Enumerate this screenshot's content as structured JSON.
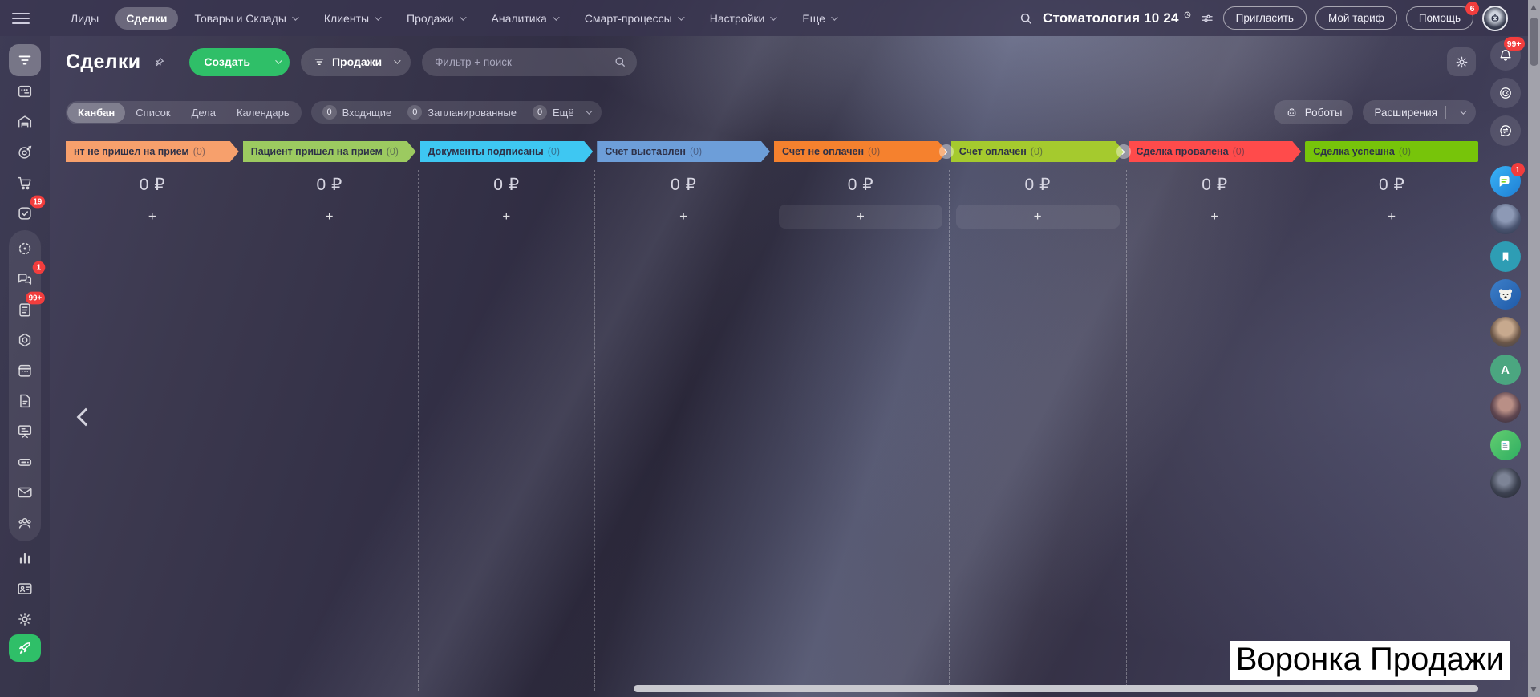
{
  "topbar": {
    "nav": [
      {
        "label": "Лиды"
      },
      {
        "label": "Сделки"
      },
      {
        "label": "Товары и Склады"
      },
      {
        "label": "Клиенты"
      },
      {
        "label": "Продажи"
      },
      {
        "label": "Аналитика"
      },
      {
        "label": "Смарт-процессы"
      },
      {
        "label": "Настройки"
      },
      {
        "label": "Еще"
      }
    ],
    "company_name": "Стоматология 10 24",
    "invite_button": "Пригласить",
    "tariff_button": "Мой тариф",
    "help_button": "Помощь",
    "help_badge": "6"
  },
  "toolbar": {
    "page_title": "Сделки",
    "create_button": "Создать",
    "funnel_selector": "Продажи",
    "filter_placeholder": "Фильтр + поиск"
  },
  "tabs_row": {
    "tabs": [
      {
        "label": "Канбан"
      },
      {
        "label": "Список"
      },
      {
        "label": "Дела"
      },
      {
        "label": "Календарь"
      }
    ],
    "counters": [
      {
        "count": "0",
        "label": "Входящие"
      },
      {
        "count": "0",
        "label": "Запланированные"
      },
      {
        "count": "0",
        "label": "Ещё"
      }
    ],
    "robots_button": "Роботы",
    "extensions_button": "Расширения"
  },
  "kanban": {
    "add_label": "+",
    "columns": [
      {
        "title": "нт не пришел на прием",
        "count_display": "(0)",
        "amount": "0 ₽",
        "color": "#f7a06c",
        "highlight_plus": false
      },
      {
        "title": "Пациент пришел на прием",
        "count_display": "(0)",
        "amount": "0 ₽",
        "color": "#9cca60",
        "highlight_plus": false
      },
      {
        "title": "Документы подписаны",
        "count_display": "(0)",
        "amount": "0 ₽",
        "color": "#3ec7f2",
        "highlight_plus": false
      },
      {
        "title": "Счет выставлен",
        "count_display": "(0)",
        "amount": "0 ₽",
        "color": "#6d9ed9",
        "highlight_plus": false
      },
      {
        "title": "Счет не оплачен",
        "count_display": "(0)",
        "amount": "0 ₽",
        "color": "#f5812e",
        "highlight_plus": true
      },
      {
        "title": "Счет оплачен",
        "count_display": "(0)",
        "amount": "0 ₽",
        "color": "#a5ca2e",
        "highlight_plus": true
      },
      {
        "title": "Сделка провалена",
        "count_display": "(0)",
        "amount": "0 ₽",
        "color": "#ff4b4b",
        "highlight_plus": false
      },
      {
        "title": "Сделка успешна",
        "count_display": "(0)",
        "amount": "0 ₽",
        "color": "#77c40a",
        "highlight_plus": false
      }
    ]
  },
  "left_sidebar": {
    "tasks_badge": "19",
    "messenger_badge": "1",
    "feed_badge": "99+"
  },
  "right_sidebar": {
    "notifications_badge": "99+",
    "messenger_badge": "1",
    "letter_avatar": "A"
  },
  "watermark": "Воронка Продажи",
  "colors": {
    "accent_green": "#2fbf68",
    "badge_red": "#f23d3d"
  }
}
